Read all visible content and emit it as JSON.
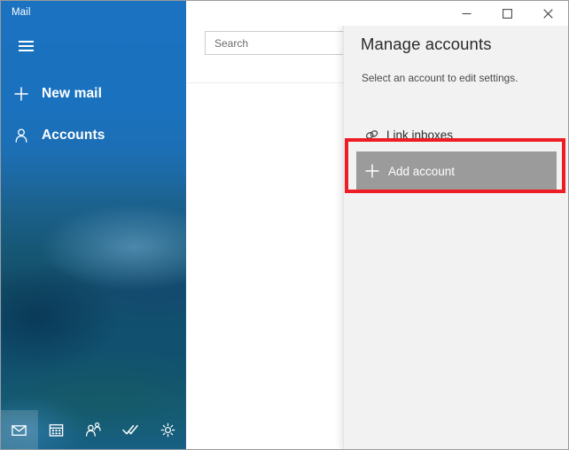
{
  "window": {
    "app_title": "Mail",
    "caption": {
      "minimize_label": "Minimize",
      "maximize_label": "Maximize",
      "close_label": "Close"
    }
  },
  "sidebar": {
    "hamburger_label": "Expand navigation pane",
    "items": [
      {
        "label": "New mail",
        "icon": "plus-icon"
      },
      {
        "label": "Accounts",
        "icon": "person-icon"
      }
    ],
    "bottom_nav": [
      {
        "label": "Mail",
        "icon": "mail-icon",
        "selected": true
      },
      {
        "label": "Calendar",
        "icon": "calendar-icon",
        "selected": false
      },
      {
        "label": "People",
        "icon": "people-icon",
        "selected": false
      },
      {
        "label": "To Do",
        "icon": "checkmark-icon",
        "selected": false
      },
      {
        "label": "Settings",
        "icon": "gear-icon",
        "selected": false
      }
    ]
  },
  "message_list": {
    "search_placeholder": "Search"
  },
  "accounts_panel": {
    "title": "Manage accounts",
    "subtitle": "Select an account to edit settings.",
    "rows": [
      {
        "label": "Link inboxes",
        "icon": "link-icon",
        "highlighted": false
      },
      {
        "label": "Add account",
        "icon": "plus-icon",
        "highlighted": true
      }
    ]
  },
  "annotation": {
    "highlight_target": "Add account",
    "color": "#ee1c25"
  },
  "colors": {
    "accent_blue": "#1b72c0",
    "panel_background": "#f2f2f2",
    "selected_row": "#9b9b9b",
    "annotation_red": "#ee1c25"
  }
}
